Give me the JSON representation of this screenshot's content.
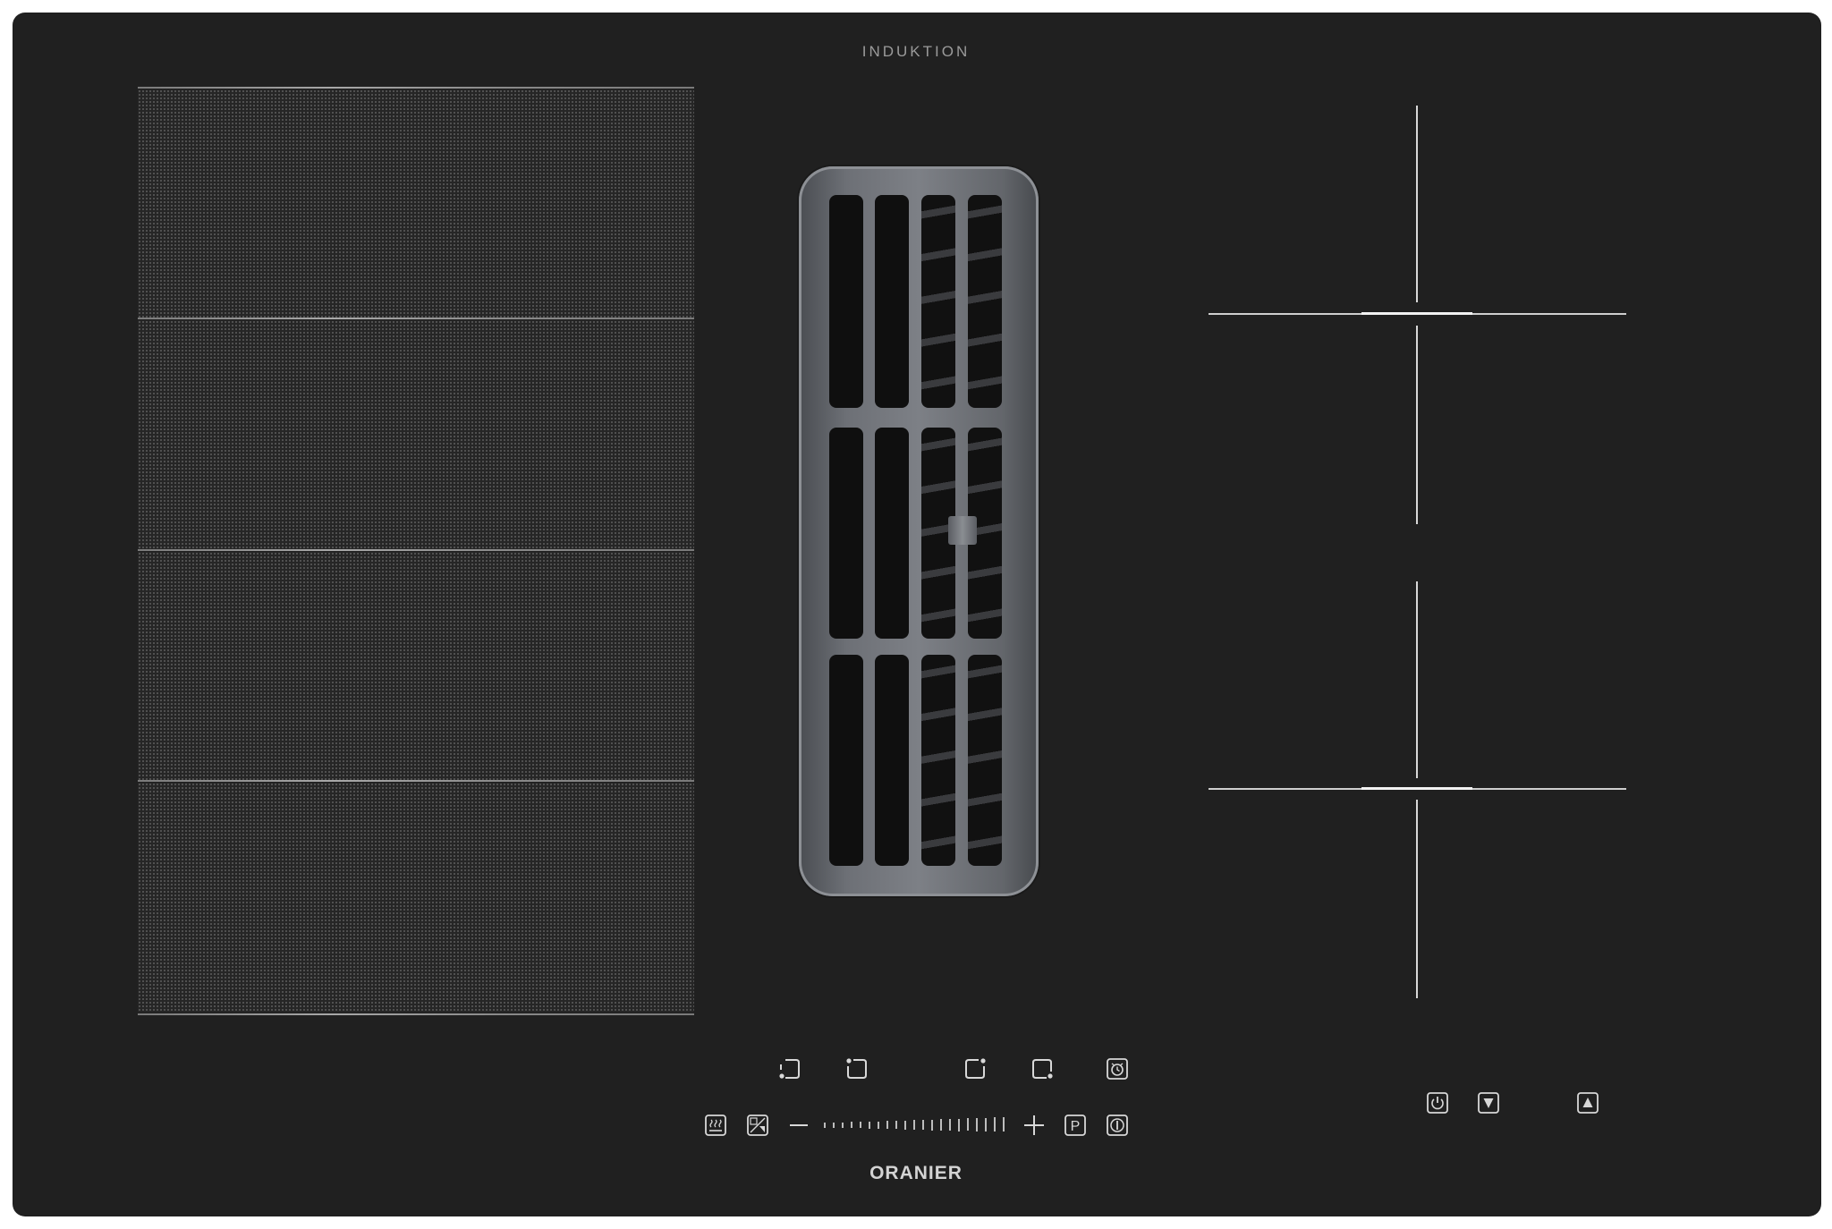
{
  "header": {
    "label": "INDUKTION"
  },
  "left_flex_zone": {
    "sections": 4
  },
  "downdraft_vent": {
    "slot_columns": 4,
    "slot_rows": 3
  },
  "right_zones": {
    "count": 4
  },
  "controls": {
    "zone_selectors": [
      {
        "icon": "zone-bottom-left-icon"
      },
      {
        "icon": "zone-top-left-icon"
      },
      {
        "icon": "zone-top-right-icon"
      },
      {
        "icon": "zone-bottom-right-icon"
      }
    ],
    "timer": {
      "icon": "timer-icon"
    },
    "keep_warm": {
      "icon": "keep-warm-icon"
    },
    "flex_mode": {
      "icon": "flex-zone-icon"
    },
    "minus": {
      "icon": "minus-icon"
    },
    "plus": {
      "icon": "plus-icon"
    },
    "pause": {
      "icon": "pause-icon",
      "glyph": "P"
    },
    "power_main": {
      "icon": "power-icon"
    },
    "hood_power": {
      "icon": "hood-power-icon"
    },
    "hood_down": {
      "icon": "triangle-down-icon"
    },
    "hood_up": {
      "icon": "triangle-up-icon"
    }
  },
  "brand": {
    "name": "ORANIER"
  },
  "colors": {
    "surface": "#202020",
    "print": "#d8d8d8",
    "vent": "#6d7076"
  }
}
